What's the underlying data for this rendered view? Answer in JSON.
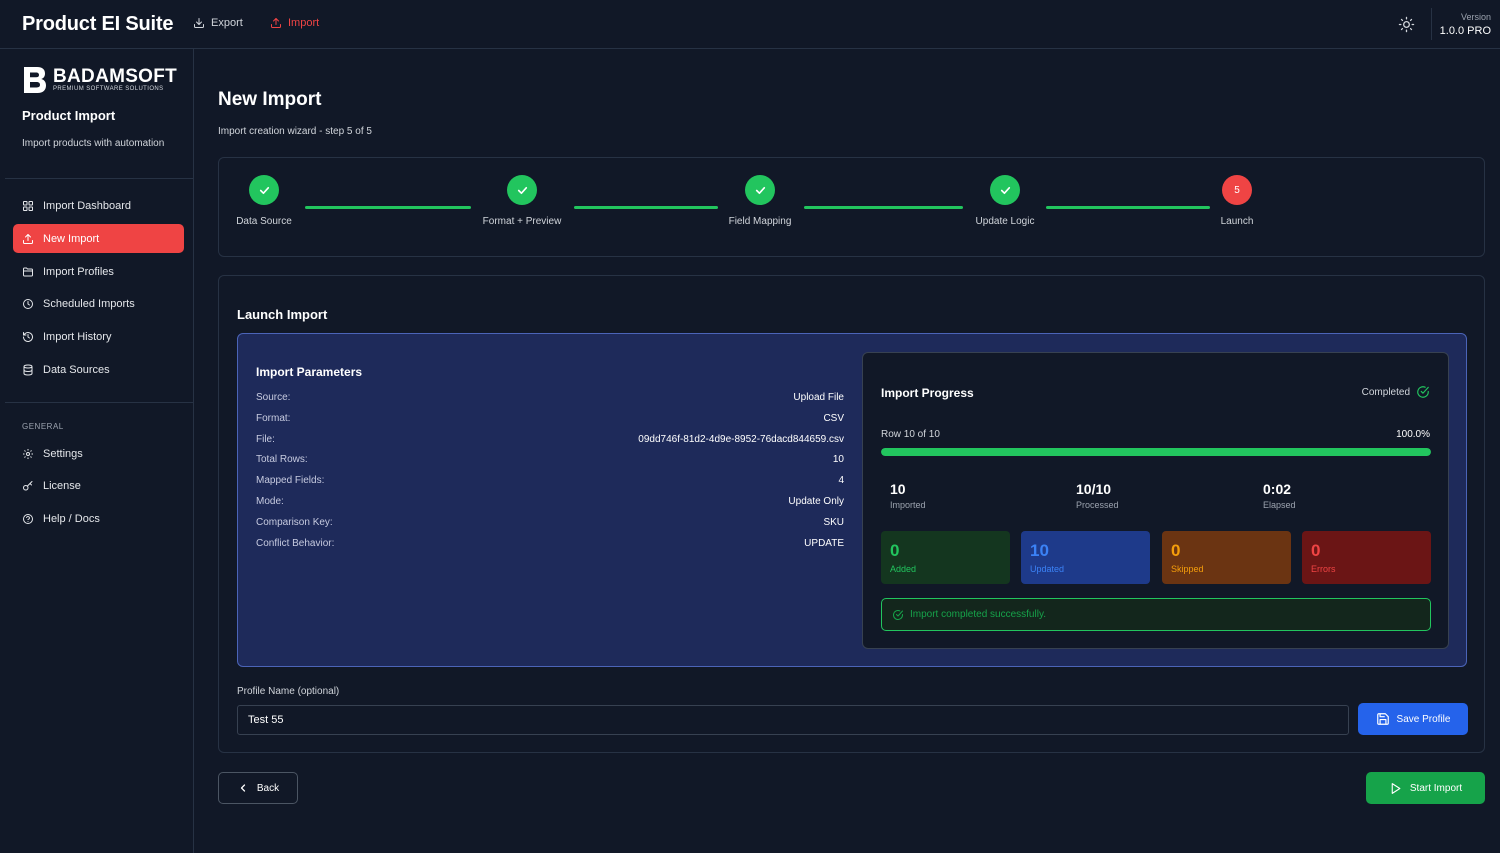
{
  "app": {
    "title": "Product EI Suite",
    "nav": {
      "export": "Export",
      "import": "Import"
    },
    "version_label": "Version",
    "version_value": "1.0.0 PRO"
  },
  "sidebar": {
    "brand_name": "BADAMSOFT",
    "brand_tagline": "PREMIUM SOFTWARE SOLUTIONS",
    "title": "Product Import",
    "subtitle": "Import products with automation",
    "items": [
      {
        "label": "Import Dashboard",
        "icon": "grid-icon"
      },
      {
        "label": "New Import",
        "icon": "upload-icon",
        "active": true
      },
      {
        "label": "Import Profiles",
        "icon": "folder-icon"
      },
      {
        "label": "Scheduled Imports",
        "icon": "clock-icon"
      },
      {
        "label": "Import History",
        "icon": "history-icon"
      },
      {
        "label": "Data Sources",
        "icon": "database-icon"
      }
    ],
    "general_section": "GENERAL",
    "general_items": [
      {
        "label": "Settings",
        "icon": "gear-icon"
      },
      {
        "label": "License",
        "icon": "key-icon"
      },
      {
        "label": "Help / Docs",
        "icon": "help-icon"
      }
    ]
  },
  "page": {
    "title": "New Import",
    "subtitle": "Import creation wizard - step 5 of 5"
  },
  "stepper": {
    "steps": [
      {
        "label": "Data Source",
        "state": "done"
      },
      {
        "label": "Format + Preview",
        "state": "done"
      },
      {
        "label": "Field Mapping",
        "state": "done"
      },
      {
        "label": "Update Logic",
        "state": "done"
      },
      {
        "label": "Launch",
        "state": "current",
        "number": "5"
      }
    ]
  },
  "launch": {
    "title": "Launch Import",
    "params_title": "Import Parameters",
    "params": [
      {
        "key": "Source:",
        "value": "Upload File"
      },
      {
        "key": "Format:",
        "value": "CSV"
      },
      {
        "key": "File:",
        "value": "09dd746f-81d2-4d9e-8952-76dacd844659.csv"
      },
      {
        "key": "Total Rows:",
        "value": "10"
      },
      {
        "key": "Mapped Fields:",
        "value": "4"
      },
      {
        "key": "Mode:",
        "value": "Update Only"
      },
      {
        "key": "Comparison Key:",
        "value": "SKU"
      },
      {
        "key": "Conflict Behavior:",
        "value": "UPDATE"
      }
    ],
    "progress": {
      "title": "Import Progress",
      "status": "Completed",
      "row_text": "Row 10 of 10",
      "percent_text": "100.0%",
      "fraction": 1.0,
      "stats": [
        {
          "value": "10",
          "label": "Imported"
        },
        {
          "value": "10/10",
          "label": "Processed"
        },
        {
          "value": "0:02",
          "label": "Elapsed"
        }
      ],
      "tiles": {
        "added": {
          "value": "0",
          "label": "Added"
        },
        "updated": {
          "value": "10",
          "label": "Updated"
        },
        "skipped": {
          "value": "0",
          "label": "Skipped"
        },
        "errors": {
          "value": "0",
          "label": "Errors"
        }
      },
      "success_message": "Import completed successfully."
    },
    "profile_label": "Profile Name (optional)",
    "profile_value": "Test 55",
    "save_label": "Save Profile"
  },
  "footer": {
    "back_label": "Back",
    "start_label": "Start Import"
  },
  "colors": {
    "accent": "#ef4444",
    "success": "#22c55e",
    "primary": "#2563eb",
    "background": "#111827"
  }
}
